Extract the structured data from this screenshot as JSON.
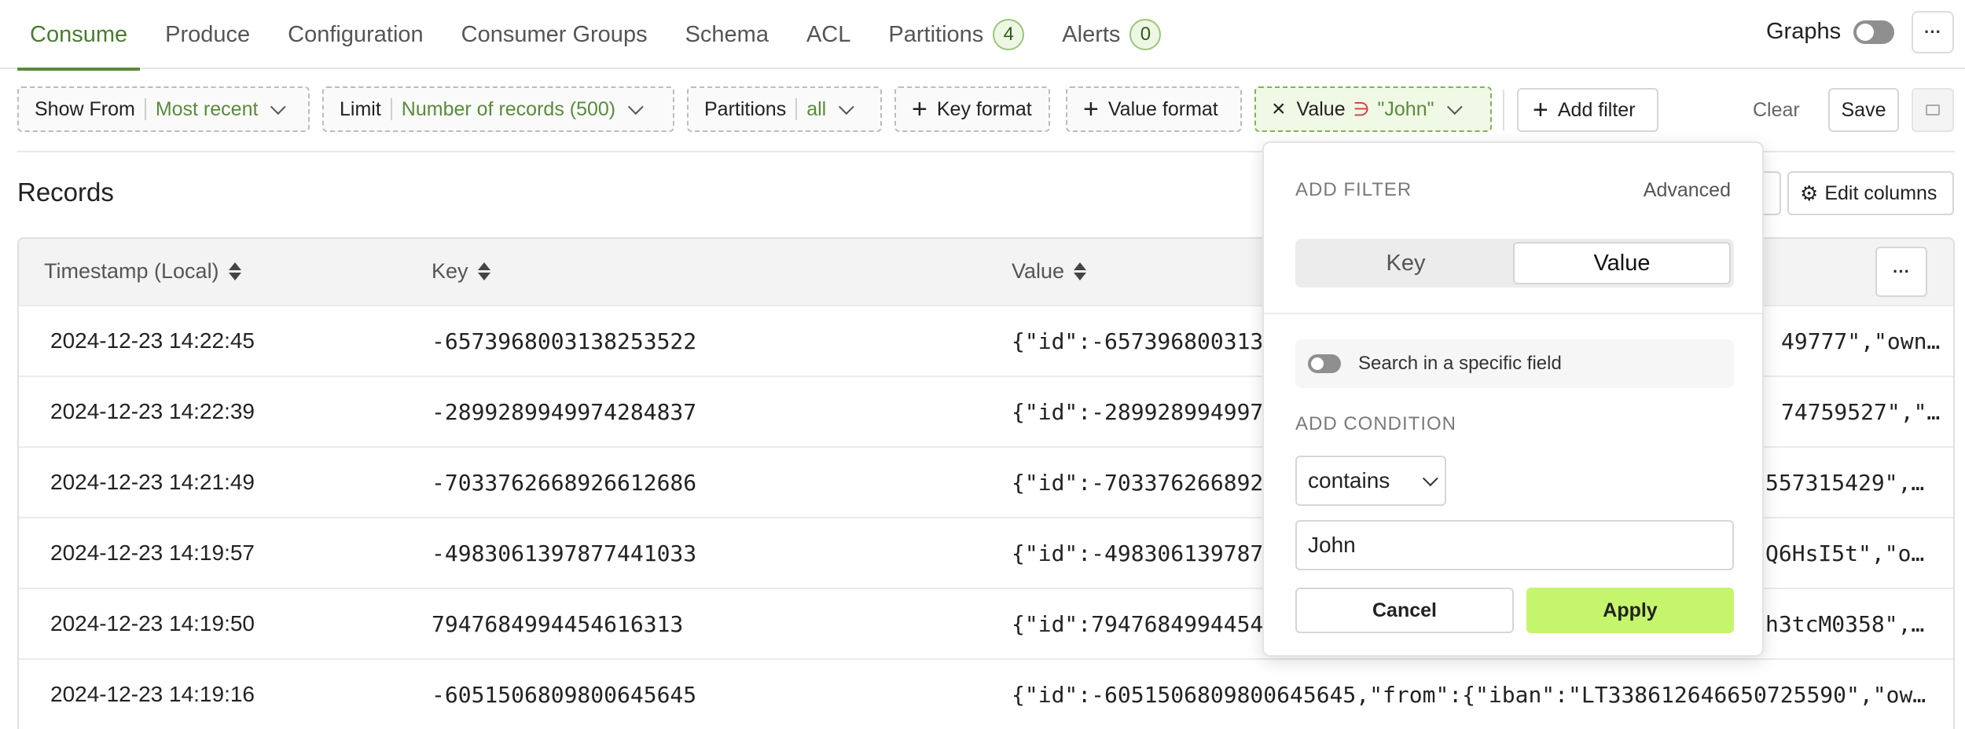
{
  "tabs": [
    {
      "label": "Consume",
      "active": true
    },
    {
      "label": "Produce"
    },
    {
      "label": "Configuration"
    },
    {
      "label": "Consumer Groups"
    },
    {
      "label": "Schema"
    },
    {
      "label": "ACL"
    },
    {
      "label": "Partitions",
      "badge": "4"
    },
    {
      "label": "Alerts",
      "badge": "0"
    }
  ],
  "graphs_label": "Graphs",
  "more_label": "···",
  "filters": {
    "show_from_label": "Show From",
    "show_from_value": "Most recent",
    "limit_label": "Limit",
    "limit_value": "Number of records (500)",
    "partitions_label": "Partitions",
    "partitions_value": "all",
    "key_format": "Key format",
    "value_format": "Value format",
    "value_filter_field": "Value",
    "value_filter_op": "∋",
    "value_filter_value": "\"John\"",
    "add_filter": "Add filter",
    "clear": "Clear",
    "save": "Save"
  },
  "records": {
    "title": "Records",
    "edit_columns": "Edit columns",
    "columns": [
      "Timestamp (Local)",
      "Key",
      "Value"
    ],
    "rows": [
      {
        "ts": "2024-12-23 14:22:45",
        "key": "-6573968003138253522",
        "value_start": "{\"id\":-657396800313",
        "value_end": "49777\",\"own…"
      },
      {
        "ts": "2024-12-23 14:22:39",
        "key": "-2899289949974284837",
        "value_start": "{\"id\":-289928994997",
        "value_end": "74759527\",\"…"
      },
      {
        "ts": "2024-12-23 14:21:49",
        "key": "-7033762668926612686",
        "value_start": "{\"id\":-703376266892",
        "value_end": "557315429\",…"
      },
      {
        "ts": "2024-12-23 14:19:57",
        "key": "-4983061397877441033",
        "value_start": "{\"id\":-498306139787",
        "value_end": "Q6HsI5t\",\"o…"
      },
      {
        "ts": "2024-12-23 14:19:50",
        "key": "7947684994454616313",
        "value_start": "{\"id\":7947684994454",
        "value_end": "h3tcM0358\",…"
      },
      {
        "ts": "2024-12-23 14:19:16",
        "key": "-6051506809800645645",
        "value_start": "{\"id\":-6051506809800645645,\"from\":{\"iban\":\"LT338612646650725590\",\"ow…",
        "value_end": ""
      }
    ]
  },
  "popover": {
    "title": "ADD FILTER",
    "advanced": "Advanced",
    "seg_key": "Key",
    "seg_value": "Value",
    "specific_field": "Search in a specific field",
    "condition_title": "ADD CONDITION",
    "condition": "contains",
    "input_value": "John",
    "cancel": "Cancel",
    "apply": "Apply"
  },
  "colors": {
    "accent": "#5a8b3c",
    "apply": "#c5f56d"
  }
}
